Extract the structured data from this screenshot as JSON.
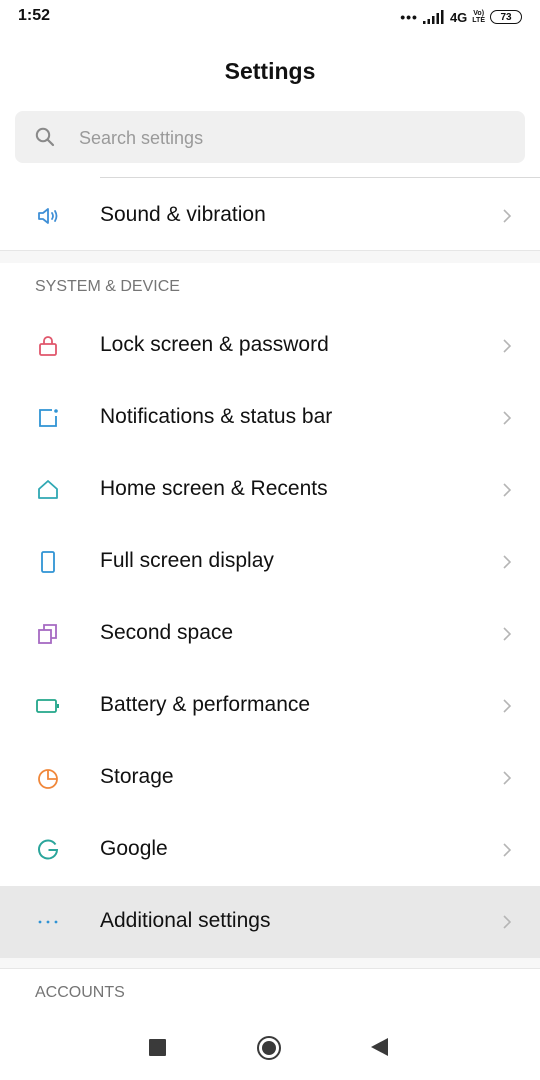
{
  "status_bar": {
    "time": "1:52",
    "dots": "•••",
    "network": "4G",
    "volte_top": "Vo)",
    "volte_bottom": "LTE",
    "battery": "73"
  },
  "header": {
    "title": "Settings"
  },
  "search": {
    "placeholder": "Search settings",
    "icon": "search-icon"
  },
  "items_top": [
    {
      "label": "Sound & vibration",
      "icon": "speaker-icon",
      "color": "#3f8fd6"
    }
  ],
  "sections": [
    {
      "title": "SYSTEM & DEVICE",
      "items": [
        {
          "label": "Lock screen & password",
          "icon": "lock-icon",
          "color": "#e0566b"
        },
        {
          "label": "Notifications & status bar",
          "icon": "notification-icon",
          "color": "#2f93d4"
        },
        {
          "label": "Home screen & Recents",
          "icon": "home-icon",
          "color": "#2fa8b3"
        },
        {
          "label": "Full screen display",
          "icon": "phone-icon",
          "color": "#2f93d4"
        },
        {
          "label": "Second space",
          "icon": "second-space-icon",
          "color": "#a66ac2"
        },
        {
          "label": "Battery & performance",
          "icon": "battery-icon",
          "color": "#22a68a"
        },
        {
          "label": "Storage",
          "icon": "storage-pie-icon",
          "color": "#f0873a"
        },
        {
          "label": "Google",
          "icon": "google-icon",
          "color": "#2aa59b"
        },
        {
          "label": "Additional settings",
          "icon": "more-dots-icon",
          "color": "#2f93d4",
          "highlighted": true
        }
      ]
    },
    {
      "title": "ACCOUNTS",
      "items": []
    }
  ],
  "nav_bar": {
    "recent": "recents-button",
    "home": "home-button",
    "back": "back-button"
  }
}
